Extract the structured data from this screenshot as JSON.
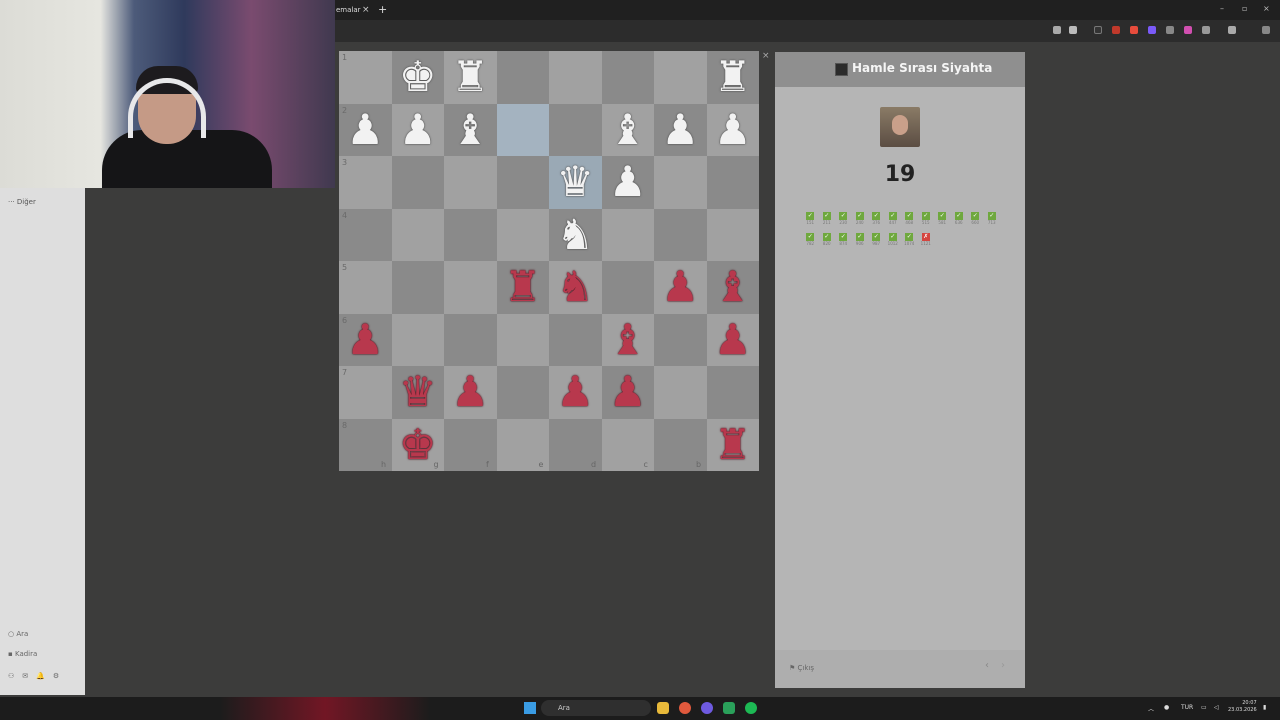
{
  "browser": {
    "tab_title": "emalar",
    "tab_close": "×",
    "new_tab": "+",
    "minimize": "–",
    "maximize": "▫",
    "close": "×"
  },
  "sidebar": {
    "more_label": "Diğer",
    "search_label": "Ara",
    "profile_label": "Kadira"
  },
  "board": {
    "close": "×",
    "ranks": [
      "1",
      "2",
      "3",
      "4",
      "5",
      "6",
      "7",
      "8"
    ],
    "files": [
      "h",
      "g",
      "f",
      "e",
      "d",
      "c",
      "b"
    ]
  },
  "panel": {
    "turn_label": "Hamle Sırası Siyahta",
    "score": "19",
    "results": [
      {
        "mark": "✓",
        "n": "151"
      },
      {
        "mark": "✓",
        "n": "211"
      },
      {
        "mark": "✓",
        "n": "230"
      },
      {
        "mark": "✓",
        "n": "240"
      },
      {
        "mark": "✓",
        "n": "376"
      },
      {
        "mark": "✓",
        "n": "447"
      },
      {
        "mark": "✓",
        "n": "468"
      },
      {
        "mark": "✓",
        "n": "515"
      },
      {
        "mark": "✓",
        "n": "581"
      },
      {
        "mark": "✓",
        "n": "636"
      },
      {
        "mark": "✓",
        "n": "660"
      },
      {
        "mark": "✓",
        "n": "713"
      },
      {
        "mark": "✓",
        "n": "782"
      },
      {
        "mark": "✓",
        "n": "820"
      },
      {
        "mark": "✓",
        "n": "874"
      },
      {
        "mark": "✓",
        "n": "906"
      },
      {
        "mark": "✓",
        "n": "987"
      },
      {
        "mark": "✓",
        "n": "1012"
      },
      {
        "mark": "✓",
        "n": "1074"
      },
      {
        "mark": "✗",
        "n": "1121"
      }
    ],
    "resign_label": "Çıkış",
    "prev": "‹",
    "next": "›"
  },
  "taskbar": {
    "search_placeholder": "Ara",
    "lang": "TUR",
    "time": "20:07",
    "date": "23.03.2026"
  },
  "colors": {
    "accent_green": "#6fa83e",
    "error_red": "#d4453f",
    "black_piece": "#b8384d"
  }
}
